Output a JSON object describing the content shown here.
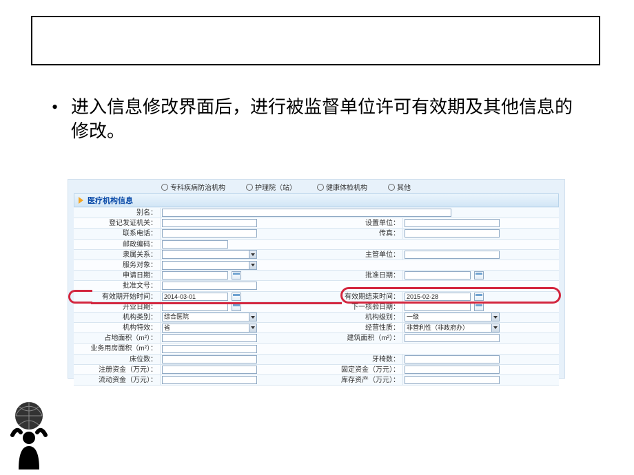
{
  "bullet_text": "进入信息修改界面后，进行被监督单位许可有效期及其他信息的修改。",
  "radios": [
    "专科疾病防治机构",
    "护理院（站）",
    "健康体检机构",
    "其他"
  ],
  "section_title": "医疗机构信息",
  "rows": [
    {
      "left_label": "别名：",
      "left_type": "text-long"
    },
    {
      "left_label": "登记发证机关：",
      "left_type": "text",
      "right_label": "设置单位：",
      "right_type": "text"
    },
    {
      "left_label": "联系电话：",
      "left_type": "text",
      "right_label": "传真：",
      "right_type": "text"
    },
    {
      "left_label": "邮政编码：",
      "left_type": "short"
    },
    {
      "left_label": "隶属关系：",
      "left_type": "select",
      "right_label": "主管单位：",
      "right_type": "text"
    },
    {
      "left_label": "服务对象：",
      "left_type": "select"
    },
    {
      "left_label": "申请日期：",
      "left_type": "date",
      "right_label": "批准日期：",
      "right_type": "date"
    },
    {
      "left_label": "批准文号：",
      "left_type": "text"
    },
    {
      "left_label": "有效期开始时间：",
      "left_type": "date",
      "left_value": "2014-03-01",
      "right_label": "有效期结束时间：",
      "right_type": "date",
      "right_value": "2015-02-28",
      "highlight": true
    },
    {
      "left_label": "开业日期：",
      "left_type": "date",
      "right_label": "下一核验日期：",
      "right_type": "date"
    },
    {
      "left_label": "机构类别：",
      "left_type": "select",
      "left_value": "综合医院",
      "right_label": "机构级别：",
      "right_type": "select",
      "right_value": "一级"
    },
    {
      "left_label": "机构特效：",
      "left_type": "select",
      "left_value": "省",
      "right_label": "经营性质：",
      "right_type": "select",
      "right_value": "非营利性（非政府办）"
    },
    {
      "left_label": "占地面积（m²）：",
      "left_type": "text",
      "right_label": "建筑面积（m²）：",
      "right_type": "text"
    },
    {
      "left_label": "业务用房面积（m²）：",
      "left_type": "text"
    },
    {
      "left_label": "床位数：",
      "left_type": "text",
      "right_label": "牙椅数：",
      "right_type": "text"
    },
    {
      "left_label": "注册资金（万元）：",
      "left_type": "text",
      "right_label": "固定资金（万元）：",
      "right_type": "text"
    },
    {
      "left_label": "流动资金（万元）：",
      "left_type": "text",
      "right_label": "库存资产（万元）：",
      "right_type": "text"
    }
  ]
}
